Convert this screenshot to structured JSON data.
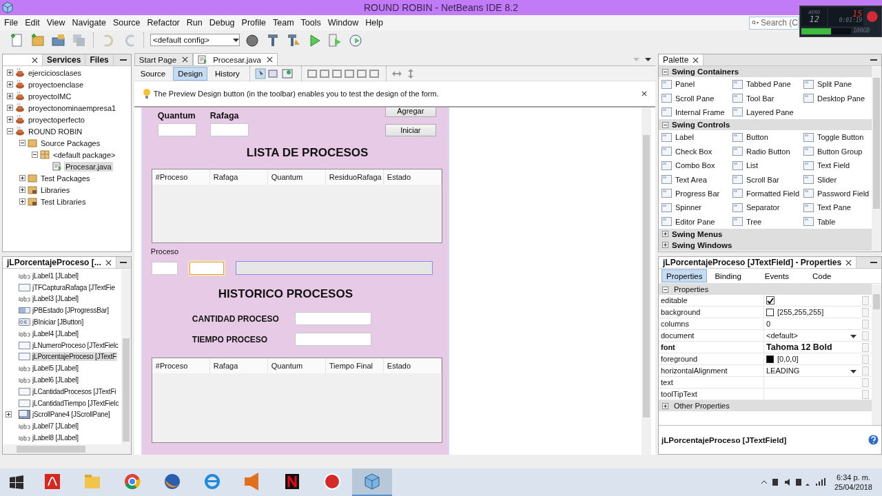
{
  "window": {
    "title": "ROUND ROBIN - NetBeans IDE 8.2"
  },
  "menu": [
    "File",
    "Edit",
    "View",
    "Navigate",
    "Source",
    "Refactor",
    "Run",
    "Debug",
    "Profile",
    "Team",
    "Tools",
    "Window",
    "Help"
  ],
  "toolbar": {
    "buttons": [
      {
        "kind": "new-file",
        "disabled": false
      },
      {
        "kind": "new-project",
        "disabled": false
      },
      {
        "kind": "open-project",
        "disabled": false
      },
      {
        "kind": "save-all",
        "disabled": true
      },
      {
        "kind": "undo",
        "disabled": true
      },
      {
        "kind": "redo",
        "disabled": true
      },
      {
        "kind": "globe",
        "disabled": false
      },
      {
        "kind": "build",
        "disabled": false
      },
      {
        "kind": "clean-build",
        "disabled": false
      },
      {
        "kind": "run",
        "disabled": false
      },
      {
        "kind": "debug",
        "disabled": false
      },
      {
        "kind": "profile",
        "disabled": false
      }
    ],
    "config": "<default config>"
  },
  "search": {
    "placeholder": "Search (C"
  },
  "recorder": {
    "mode": "AERO",
    "fps": "12",
    "frames": "15",
    "time": "0:01:19",
    "disk": "100GB",
    "level": 0.6
  },
  "projects": {
    "tabs": [
      {
        "label": "Services",
        "selected": false
      },
      {
        "label": "Files",
        "selected": false
      }
    ],
    "tree": [
      {
        "label": "ejerciciosclases",
        "kind": "project",
        "expanded": false,
        "selected": false
      },
      {
        "label": "proyectoenclase",
        "kind": "project",
        "expanded": false,
        "selected": false
      },
      {
        "label": "proyectoIMC",
        "kind": "project",
        "expanded": false,
        "selected": false
      },
      {
        "label": "proyectonominaempresa1",
        "kind": "project",
        "expanded": false,
        "selected": false
      },
      {
        "label": "proyectoperfecto",
        "kind": "project",
        "expanded": false,
        "selected": false
      },
      {
        "label": "ROUND ROBIN",
        "kind": "project",
        "expanded": true,
        "selected": false,
        "children": [
          {
            "label": "Source Packages",
            "kind": "package-folder",
            "expanded": true,
            "selected": false,
            "children": [
              {
                "label": "<default package>",
                "kind": "package",
                "expanded": true,
                "selected": false,
                "children": [
                  {
                    "label": "Procesar.java",
                    "kind": "form",
                    "selected": true
                  }
                ]
              }
            ]
          },
          {
            "label": "Test Packages",
            "kind": "package-folder",
            "expanded": false,
            "selected": false
          },
          {
            "label": "Libraries",
            "kind": "library",
            "expanded": false,
            "selected": false
          },
          {
            "label": "Test Libraries",
            "kind": "library",
            "expanded": false,
            "selected": false
          }
        ]
      }
    ]
  },
  "navigator": {
    "title": "jLPorcentajeProceso [...",
    "items": [
      {
        "label": "jLabel1 [JLabel]",
        "kind": "label",
        "selected": false
      },
      {
        "label": "jTFCapturaRafaga [JTextFie",
        "kind": "textfield",
        "selected": false
      },
      {
        "label": "jLabel3 [JLabel]",
        "kind": "label",
        "selected": false
      },
      {
        "label": "jPBEstado [JProgressBar]",
        "kind": "progressbar",
        "selected": false
      },
      {
        "label": "jBIniciar [JButton]",
        "kind": "button",
        "selected": false
      },
      {
        "label": "jLabel4 [JLabel]",
        "kind": "label",
        "selected": false
      },
      {
        "label": "jLNumeroProceso [JTextFielc",
        "kind": "textfield",
        "selected": false
      },
      {
        "label": "jLPorcentajeProceso [JTextF",
        "kind": "textfield",
        "selected": true
      },
      {
        "label": "jLabel5 [JLabel]",
        "kind": "label",
        "selected": false
      },
      {
        "label": "jLabel6 [JLabel]",
        "kind": "label",
        "selected": false
      },
      {
        "label": "jLCantidadProcesos [JTextFi",
        "kind": "textfield",
        "selected": false
      },
      {
        "label": "jLCantidadTiempo [JTextFielc",
        "kind": "textfield",
        "selected": false
      },
      {
        "label": "jScrollPane4 [JScrollPane]",
        "kind": "scrollpane",
        "selected": false,
        "expanded": false
      },
      {
        "label": "jLabel7 [JLabel]",
        "kind": "label",
        "selected": false
      },
      {
        "label": "jLabel8 [JLabel]",
        "kind": "label",
        "selected": false
      }
    ]
  },
  "editor": {
    "tabs": [
      {
        "label": "Start Page",
        "selected": false
      },
      {
        "label": "Procesar.java",
        "selected": true
      }
    ],
    "views": [
      {
        "label": "Source",
        "selected": false
      },
      {
        "label": "Design",
        "selected": true
      },
      {
        "label": "History",
        "selected": false
      }
    ],
    "hint": "The Preview Design button (in the toolbar) enables you to test the design of the form.",
    "form": {
      "quantum_label": "Quantum",
      "rafaga_label": "Rafaga",
      "buttons": [
        "Agregar",
        "Iniciar"
      ],
      "list_title": "LISTA DE PROCESOS",
      "list_columns": [
        "#Proceso",
        "Rafaga",
        "Quantum",
        "ResiduoRafaga",
        "Estado"
      ],
      "proceso_label": "Proceso",
      "proceso_fields": [
        {
          "selected": false
        },
        {
          "selected": true
        }
      ],
      "progress": {
        "level": 0
      },
      "history_title": "HISTORICO PROCESOS",
      "history_fields": [
        {
          "label": "CANTIDAD PROCESO"
        },
        {
          "label": "TIEMPO PROCESO"
        }
      ],
      "history_columns": [
        "#Proceso",
        "Rafaga",
        "Quantum",
        "Tiempo Final",
        "Estado"
      ]
    }
  },
  "palette": {
    "title": "Palette",
    "sections": [
      {
        "title": "Swing Containers",
        "expanded": true,
        "items": [
          "Panel",
          "Tabbed Pane",
          "Split Pane",
          "Scroll Pane",
          "Tool Bar",
          "Desktop Pane",
          "Internal Frame",
          "Layered Pane"
        ]
      },
      {
        "title": "Swing Controls",
        "expanded": true,
        "items": [
          "Label",
          "Button",
          "Toggle Button",
          "Check Box",
          "Radio Button",
          "Button Group",
          "Combo Box",
          "List",
          "Text Field",
          "Text Area",
          "Scroll Bar",
          "Slider",
          "Progress Bar",
          "Formatted Field",
          "Password Field",
          "Spinner",
          "Separator",
          "Text Pane",
          "Editor Pane",
          "Tree",
          "Table"
        ]
      },
      {
        "title": "Swing Menus",
        "expanded": false
      },
      {
        "title": "Swing Windows",
        "expanded": false
      }
    ]
  },
  "properties": {
    "title": "jLPorcentajeProceso [JTextField] - Properties",
    "tabs": [
      {
        "label": "Properties",
        "selected": true
      },
      {
        "label": "Binding",
        "selected": false
      },
      {
        "label": "Events",
        "selected": false
      },
      {
        "label": "Code",
        "selected": false
      }
    ],
    "sections": [
      {
        "title": "Properties",
        "expanded": true,
        "rows": [
          {
            "name": "editable",
            "kind": "checkbox",
            "checked": true
          },
          {
            "name": "background",
            "kind": "color",
            "color": "#ffffff",
            "value": "[255,255,255]"
          },
          {
            "name": "columns",
            "kind": "text",
            "value": "0"
          },
          {
            "name": "document",
            "kind": "dropdown",
            "value": "<default>"
          },
          {
            "name": "font",
            "kind": "bold",
            "value": "Tahoma 12 Bold"
          },
          {
            "name": "foreground",
            "kind": "color",
            "color": "#000000",
            "value": "[0,0,0]"
          },
          {
            "name": "horizontalAlignment",
            "kind": "dropdown",
            "value": "LEADING"
          },
          {
            "name": "text",
            "kind": "text"
          },
          {
            "name": "toolTipText",
            "kind": "text"
          }
        ]
      },
      {
        "title": "Other Properties",
        "expanded": false
      }
    ],
    "footer": "jLPorcentajeProceso [JTextField]"
  },
  "taskbar": {
    "apps": [
      {
        "kind": "acrobat",
        "selected": false
      },
      {
        "kind": "explorer",
        "selected": false
      },
      {
        "kind": "chrome",
        "selected": false
      },
      {
        "kind": "firefox",
        "selected": false
      },
      {
        "kind": "ie",
        "selected": false
      },
      {
        "kind": "media",
        "selected": false
      },
      {
        "kind": "netflix",
        "selected": false
      },
      {
        "kind": "recorder",
        "selected": false
      },
      {
        "kind": "netbeans",
        "selected": true
      }
    ],
    "time": "6:34 p. m.",
    "date": "25/04/2018"
  }
}
